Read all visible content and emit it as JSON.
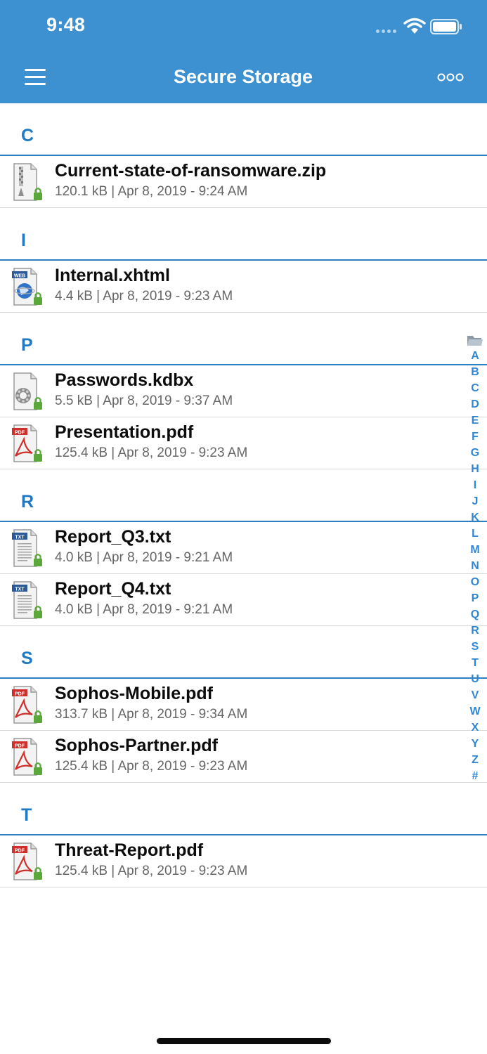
{
  "status_bar": {
    "time": "9:48"
  },
  "nav": {
    "title": "Secure Storage"
  },
  "colors": {
    "nav_background": "#3d91d0",
    "accent": "#1f79c5",
    "lock_badge": "#5aa83a",
    "pdf_red": "#d0302b"
  },
  "sections": [
    {
      "letter": "C",
      "files": [
        {
          "name": "Current-state-of-ransomware.zip",
          "meta": "120.1 kB | Apr 8, 2019 - 9:24 AM",
          "icon": "zip-file-icon"
        }
      ]
    },
    {
      "letter": "I",
      "files": [
        {
          "name": "Internal.xhtml",
          "meta": "4.4 kB | Apr 8, 2019 - 9:23 AM",
          "icon": "web-file-icon"
        }
      ]
    },
    {
      "letter": "P",
      "files": [
        {
          "name": "Passwords.kdbx",
          "meta": "5.5 kB | Apr 8, 2019 - 9:37 AM",
          "icon": "generic-file-icon"
        },
        {
          "name": "Presentation.pdf",
          "meta": "125.4 kB | Apr 8, 2019 - 9:23 AM",
          "icon": "pdf-file-icon"
        }
      ]
    },
    {
      "letter": "R",
      "files": [
        {
          "name": "Report_Q3.txt",
          "meta": "4.0 kB | Apr 8, 2019 - 9:21 AM",
          "icon": "txt-file-icon"
        },
        {
          "name": "Report_Q4.txt",
          "meta": "4.0 kB | Apr 8, 2019 - 9:21 AM",
          "icon": "txt-file-icon"
        }
      ]
    },
    {
      "letter": "S",
      "files": [
        {
          "name": "Sophos-Mobile.pdf",
          "meta": "313.7 kB | Apr 8, 2019 - 9:34 AM",
          "icon": "pdf-file-icon"
        },
        {
          "name": "Sophos-Partner.pdf",
          "meta": "125.4 kB | Apr 8, 2019 - 9:23 AM",
          "icon": "pdf-file-icon"
        }
      ]
    },
    {
      "letter": "T",
      "files": [
        {
          "name": "Threat-Report.pdf",
          "meta": "125.4 kB | Apr 8, 2019 - 9:23 AM",
          "icon": "pdf-file-icon"
        }
      ]
    }
  ],
  "index": {
    "folder_icon": "folder-icon",
    "letters": [
      "A",
      "B",
      "C",
      "D",
      "E",
      "F",
      "G",
      "H",
      "I",
      "J",
      "K",
      "L",
      "M",
      "N",
      "O",
      "P",
      "Q",
      "R",
      "S",
      "T",
      "U",
      "V",
      "W",
      "X",
      "Y",
      "Z",
      "#"
    ]
  },
  "file_badges": {
    "pdf": "PDF",
    "txt": "TXT",
    "web": "WEB"
  }
}
